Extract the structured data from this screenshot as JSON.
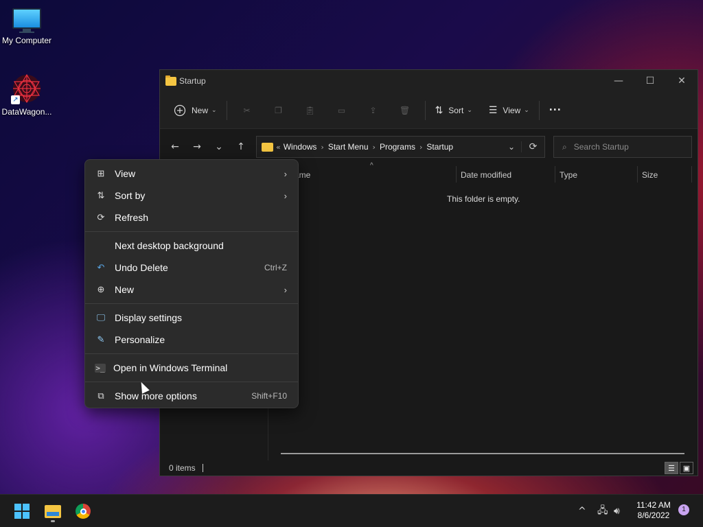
{
  "desktop": {
    "icons": [
      {
        "label": "My Computer",
        "icon": "computer-icon"
      },
      {
        "label": "DataWagon...",
        "icon": "datawagon-app-icon"
      }
    ]
  },
  "explorer": {
    "title": "Startup",
    "window_controls": {
      "minimize": "—",
      "maximize": "☐",
      "close": "✕"
    },
    "toolbar": {
      "new_label": "New",
      "sort_label": "Sort",
      "view_label": "View",
      "more_label": "···"
    },
    "nav": {
      "back": "←",
      "forward": "→",
      "recent": "⌄",
      "up": "↑"
    },
    "address": {
      "overflow": "«",
      "segments": [
        "Windows",
        "Start Menu",
        "Programs",
        "Startup"
      ],
      "separator": "›"
    },
    "search_placeholder": "Search Startup",
    "columns": {
      "name": "ame",
      "date": "Date modified",
      "type": "Type",
      "size": "Size"
    },
    "empty_message": "This folder is empty.",
    "status": {
      "items": "0 items"
    }
  },
  "context_menu": {
    "items": [
      {
        "label": "View",
        "icon": "grid-icon",
        "submenu": true
      },
      {
        "label": "Sort by",
        "icon": "sort-icon",
        "submenu": true
      },
      {
        "label": "Refresh",
        "icon": "refresh-icon"
      },
      {
        "label": "Next desktop background"
      },
      {
        "label": "Undo Delete",
        "icon": "undo-icon",
        "shortcut": "Ctrl+Z"
      },
      {
        "label": "New",
        "icon": "plus-circle-icon",
        "submenu": true
      },
      {
        "label": "Display settings",
        "icon": "display-icon"
      },
      {
        "label": "Personalize",
        "icon": "brush-icon"
      },
      {
        "label": "Open in Windows Terminal",
        "icon": "terminal-icon"
      },
      {
        "label": "Show more options",
        "icon": "more-options-icon",
        "shortcut": "Shift+F10"
      }
    ]
  },
  "taskbar": {
    "clock_time": "11:42 AM",
    "clock_date": "8/6/2022",
    "notification_count": "1",
    "tray_overflow": "^"
  },
  "colors": {
    "accent": "#4cc2ff",
    "folder": "#f4c542",
    "menu_bg": "#2b2b2b",
    "window_bg": "#191919"
  }
}
